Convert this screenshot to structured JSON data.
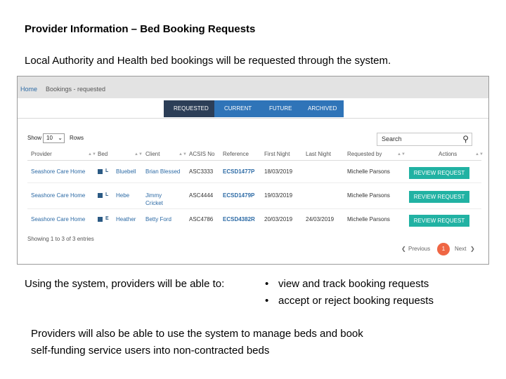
{
  "slide": {
    "title": "Provider Information – Bed Booking Requests",
    "intro": "Local Authority and Health bed bookings will be requested through the system.",
    "using_lead": "Using the system, providers will be able to:",
    "bullets": [
      "view and track booking requests",
      "accept or reject booking requests"
    ],
    "closing_line1": "Providers will also be able to use the system to manage beds and book",
    "closing_line2": "self-funding service users into non-contracted beds"
  },
  "app": {
    "breadcrumb": {
      "home": "Home",
      "current": "Bookings - requested"
    },
    "tabs": [
      "REQUESTED",
      "CURRENT",
      "FUTURE",
      "ARCHIVED"
    ],
    "active_tab": "REQUESTED",
    "show_label": "Show",
    "rows_value": "10",
    "rows_label": "Rows",
    "search_placeholder": "Search",
    "columns": [
      "Provider",
      "Bed",
      "Client",
      "ACSIS No",
      "Reference",
      "First Night",
      "Last Night",
      "Requested by",
      "Actions"
    ],
    "rows": [
      {
        "provider": "Seashore Care Home",
        "bed_letter": "L",
        "bed": "Bluebell",
        "client_line1": "Brian Blessed",
        "client_line2": "",
        "acsis": "ASC3333",
        "reference": "ECSD1477P",
        "first_night": "18/03/2019",
        "last_night": "",
        "requested_by": "Michelle Parsons",
        "action": "REVIEW REQUEST"
      },
      {
        "provider": "Seashore Care Home",
        "bed_letter": "L",
        "bed": "Hebe",
        "client_line1": "Jimmy",
        "client_line2": "Cricket",
        "acsis": "ASC4444",
        "reference": "ECSD1479P",
        "first_night": "19/03/2019",
        "last_night": "",
        "requested_by": "Michelle Parsons",
        "action": "REVIEW REQUEST"
      },
      {
        "provider": "Seashore Care Home",
        "bed_letter": "E",
        "bed": "Heather",
        "client_line1": "Betty Ford",
        "client_line2": "",
        "acsis": "ASC4786",
        "reference": "ECSD4382R",
        "first_night": "20/03/2019",
        "last_night": "24/03/2019",
        "requested_by": "Michelle Parsons",
        "action": "REVIEW REQUEST"
      }
    ],
    "showing": "Showing 1 to 3 of 3 entries",
    "pagination": {
      "previous": "Previous",
      "page": "1",
      "next": "Next"
    },
    "colors": {
      "tab_active": "#2c3e57",
      "tab": "#2f74b8",
      "action_button": "#21b2a3",
      "page_bubble": "#ef6644",
      "link": "#2c6aa5"
    },
    "icons": {
      "search": "search-icon",
      "select": "chevron-down-icon",
      "bed": "bed-icon",
      "prev": "chevron-left-icon",
      "next": "chevron-right-icon"
    }
  }
}
